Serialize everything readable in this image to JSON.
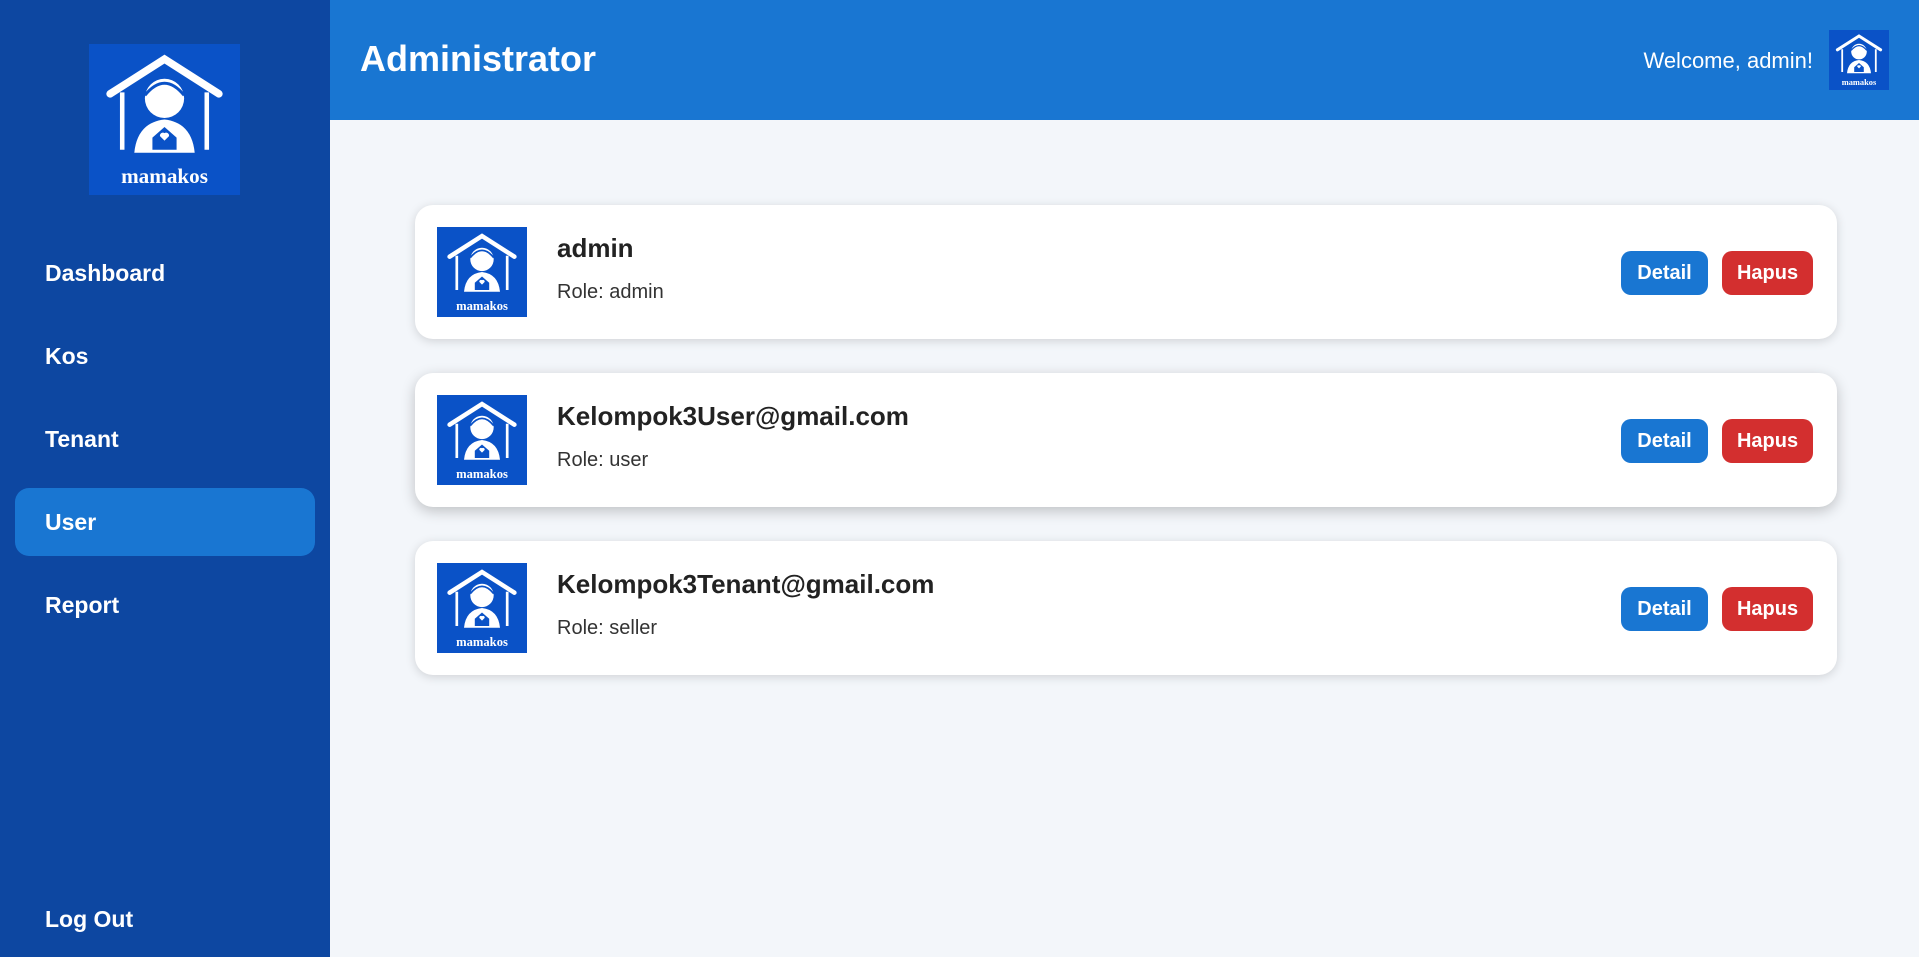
{
  "brand": {
    "logo_text": "mamakos",
    "logo_icon": "mamakos-logo-icon"
  },
  "sidebar": {
    "items": [
      {
        "label": "Dashboard",
        "active": false
      },
      {
        "label": "Kos",
        "active": false
      },
      {
        "label": "Tenant",
        "active": false
      },
      {
        "label": "User",
        "active": true
      },
      {
        "label": "Report",
        "active": false
      }
    ],
    "logout_label": "Log Out"
  },
  "header": {
    "title": "Administrator",
    "welcome": "Welcome, admin!"
  },
  "users": [
    {
      "name": "admin",
      "role": "Role: admin"
    },
    {
      "name": "Kelompok3User@gmail.com",
      "role": "Role: user"
    },
    {
      "name": "Kelompok3Tenant@gmail.com",
      "role": "Role: seller"
    }
  ],
  "actions": {
    "detail_label": "Detail",
    "delete_label": "Hapus"
  },
  "colors": {
    "sidebar_bg": "#0d47a1",
    "primary": "#1976d2",
    "danger": "#d32f2f",
    "logo_bg": "#0a52c7",
    "content_bg": "#f3f6fa"
  }
}
